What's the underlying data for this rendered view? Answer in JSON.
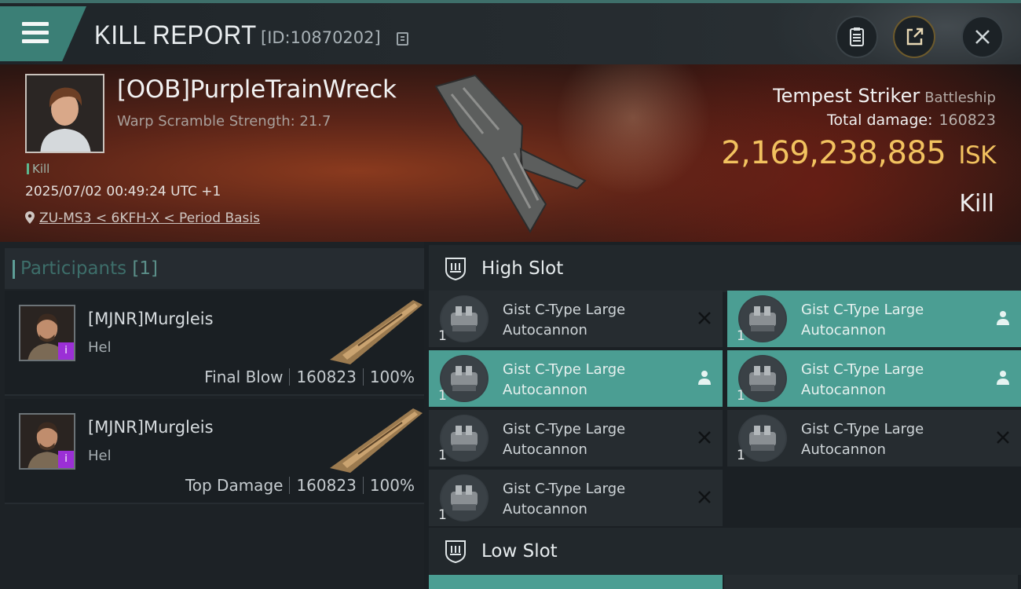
{
  "header": {
    "title": "KILL REPORT",
    "report_id": "[ID:10870202]"
  },
  "victim": {
    "name": "[OOB]PurpleTrainWreck",
    "warp_scramble": "Warp Scramble Strength: 21.7",
    "kill_tag": "Kill",
    "datetime": "2025/07/02 00:49:24 UTC +1",
    "location": "ZU-MS3 < 6KFH-X < Period Basis",
    "ship_name": "Tempest Striker",
    "ship_class": "Battleship",
    "total_damage_label": "Total damage:",
    "total_damage": "160823",
    "isk_value": "2,169,238,885",
    "isk_unit": "ISK",
    "result": "Kill"
  },
  "participants": {
    "label": "Participants",
    "count": "[1]",
    "rows": [
      {
        "name": "[MJNR]Murgleis",
        "ship": "Hel",
        "role": "Final Blow",
        "damage": "160823",
        "percent": "100%",
        "badge": "i"
      },
      {
        "name": "[MJNR]Murgleis",
        "ship": "Hel",
        "role": "Top Damage",
        "damage": "160823",
        "percent": "100%",
        "badge": "i"
      }
    ]
  },
  "slots": {
    "high_label": "High Slot",
    "low_label": "Low Slot",
    "modules": [
      {
        "line1": "Gist C-Type Large",
        "line2": "Autocannon",
        "qty": "1",
        "state": "destroyed",
        "active": false
      },
      {
        "line1": "Gist C-Type Large",
        "line2": "Autocannon",
        "qty": "1",
        "state": "dropped",
        "active": true
      },
      {
        "line1": "Gist C-Type Large",
        "line2": "Autocannon",
        "qty": "1",
        "state": "dropped",
        "active": true
      },
      {
        "line1": "Gist C-Type Large",
        "line2": "Autocannon",
        "qty": "1",
        "state": "dropped",
        "active": true
      },
      {
        "line1": "Gist C-Type Large",
        "line2": "Autocannon",
        "qty": "1",
        "state": "destroyed",
        "active": false
      },
      {
        "line1": "Gist C-Type Large",
        "line2": "Autocannon",
        "qty": "1",
        "state": "destroyed",
        "active": false
      },
      {
        "line1": "Gist C-Type Large",
        "line2": "Autocannon",
        "qty": "1",
        "state": "destroyed",
        "active": false
      }
    ]
  },
  "colors": {
    "accent": "#4b9e93",
    "isk": "#f2c25f",
    "header_bar": "#3b7f76"
  }
}
